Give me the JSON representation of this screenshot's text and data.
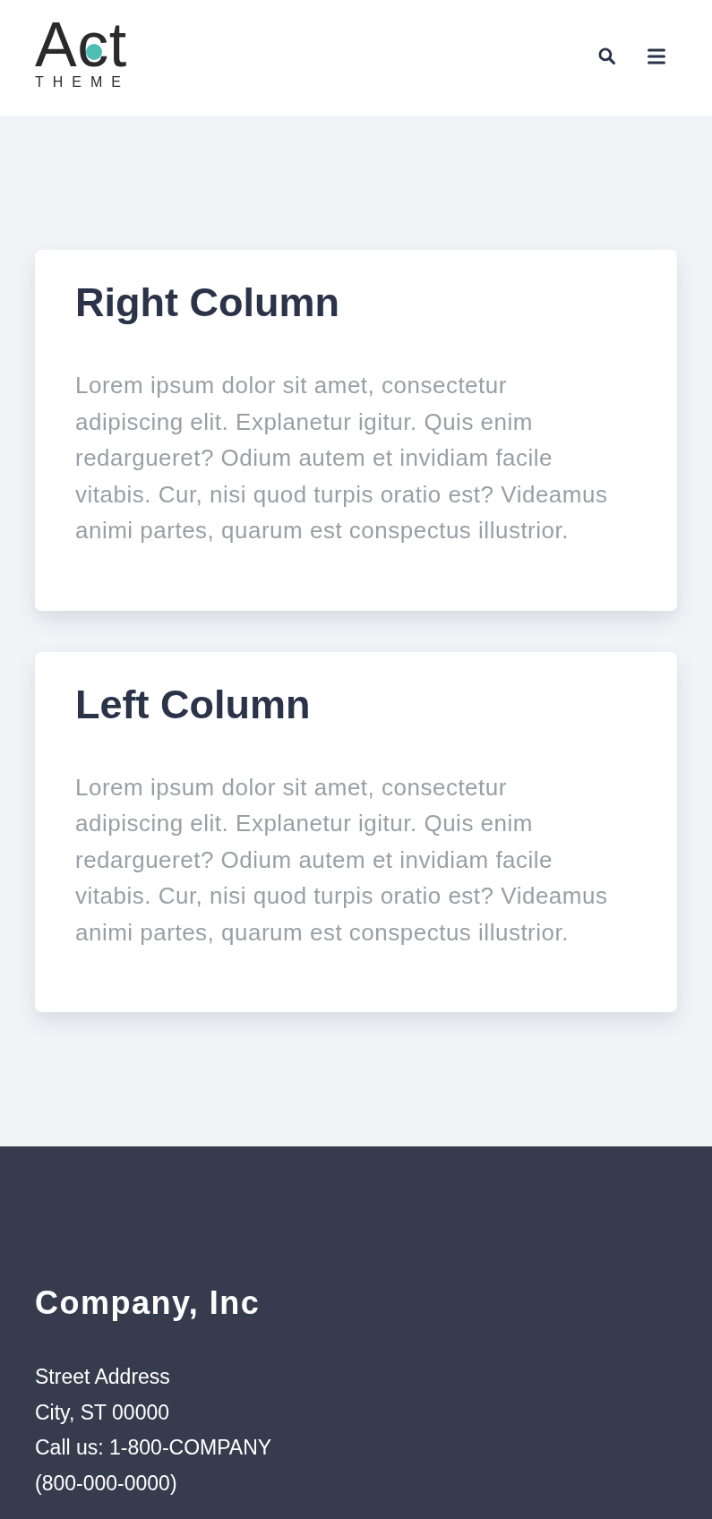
{
  "header": {
    "logo": {
      "wordmark": "Act",
      "tagline": "THEME"
    }
  },
  "cards": [
    {
      "title": "Right Column",
      "body": "Lorem ipsum dolor sit amet, consectetur adipiscing elit. Explanetur igitur. Quis enim redargueret? Odium autem et invidiam facile vitabis. Cur, nisi quod turpis oratio est? Videamus animi partes, quarum est conspectus illustrior."
    },
    {
      "title": "Left Column",
      "body": "Lorem ipsum dolor sit amet, consectetur adipiscing elit. Explanetur igitur. Quis enim redargueret? Odium autem et invidiam facile vitabis. Cur, nisi quod turpis oratio est? Videamus animi partes, quarum est conspectus illustrior."
    }
  ],
  "footer": {
    "company": "Company, Inc",
    "address_lines": [
      "Street Address",
      "City, ST 00000",
      "Call us: 1-800-COMPANY",
      "(800-000-0000)"
    ]
  }
}
